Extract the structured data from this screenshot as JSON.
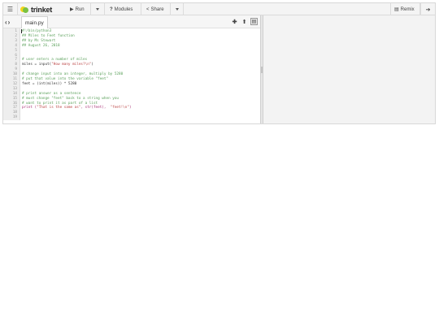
{
  "toolbar": {
    "logo_text": "trinket",
    "run_label": "Run",
    "modules_label": "Modules",
    "share_label": "Share",
    "remix_label": "Remix"
  },
  "editor": {
    "file_tab": "main.py",
    "lines": [
      {
        "n": "1",
        "text": "#!/bin/python3",
        "kind": "com"
      },
      {
        "n": "2",
        "text": "## Miles to Feet function",
        "kind": "com"
      },
      {
        "n": "3",
        "text": "## by Ms Stewart",
        "kind": "com"
      },
      {
        "n": "4",
        "text": "## August 26, 2018",
        "kind": "com"
      },
      {
        "n": "5",
        "text": "",
        "kind": "def"
      },
      {
        "n": "6",
        "text": "",
        "kind": "def"
      },
      {
        "n": "7",
        "text": "# user enters a number of miles",
        "kind": "com"
      },
      {
        "n": "8",
        "text": "miles = input(\"How many miles?\\n\")",
        "kind": "mix1"
      },
      {
        "n": "9",
        "text": "",
        "kind": "def"
      },
      {
        "n": "10",
        "text": "# change input into an integer, multiply by 5280",
        "kind": "com"
      },
      {
        "n": "11",
        "text": "# put that value into the variable \"feet\"",
        "kind": "com"
      },
      {
        "n": "12",
        "text": "feet = (int(miles)) * 5280",
        "kind": "def"
      },
      {
        "n": "13",
        "text": "",
        "kind": "def"
      },
      {
        "n": "14",
        "text": "# print answer as a sentence",
        "kind": "com"
      },
      {
        "n": "15",
        "text": "# must change \"feet\" back to a string when you",
        "kind": "com"
      },
      {
        "n": "16",
        "text": "# want to print it as part of a list",
        "kind": "com"
      },
      {
        "n": "17",
        "text": "print (\"That is the same as\", str(feet),  \"feet!\\n\")",
        "kind": "mix2"
      },
      {
        "n": "18",
        "text": "",
        "kind": "def"
      },
      {
        "n": "19",
        "text": "",
        "kind": "def"
      }
    ]
  },
  "colors": {
    "comment": "#5aa05a",
    "keyword": "#aa3377",
    "string": "#bb4444",
    "logo_yellow": "#f5d51b",
    "logo_green": "#7ac143"
  }
}
